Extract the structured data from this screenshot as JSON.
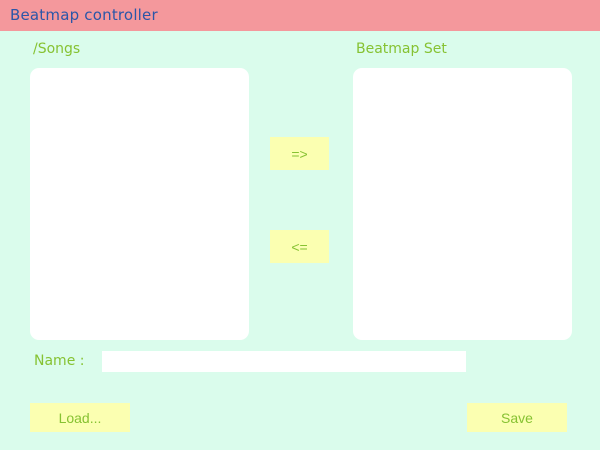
{
  "window": {
    "title": "Beatmap controller"
  },
  "songs_panel": {
    "label": "/Songs",
    "items": []
  },
  "beatmap_set_panel": {
    "label": "Beatmap Set",
    "items": []
  },
  "transfer": {
    "add_label": "=>",
    "remove_label": "<="
  },
  "name_field": {
    "label": "Name :",
    "value": "",
    "placeholder": ""
  },
  "actions": {
    "load_label": "Load...",
    "save_label": "Save"
  },
  "colors": {
    "background": "#dafcec",
    "titlebar": "#f4989c",
    "title_text": "#2b56a8",
    "label_text": "#86c232",
    "button_bg": "#fbffb1",
    "panel_bg": "#ffffff"
  }
}
